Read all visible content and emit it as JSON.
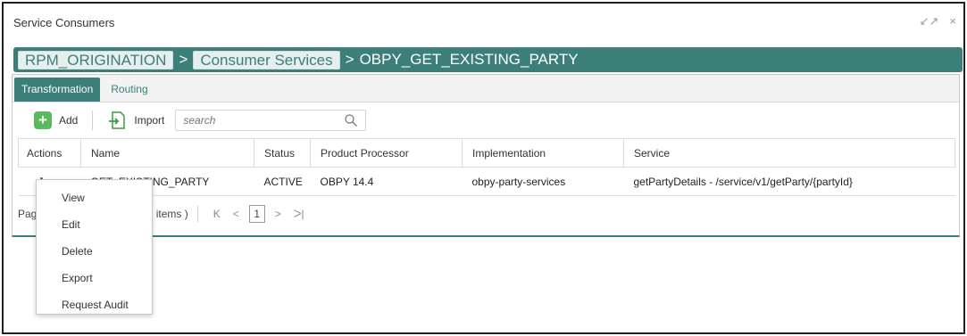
{
  "window": {
    "title": "Service Consumers",
    "minimize_icon": "↙↗",
    "close_icon": "×"
  },
  "breadcrumb": {
    "root": "RPM_ORIGINATION",
    "sep1": ">",
    "middle": "Consumer Services",
    "sep2": ">",
    "current": "OBPY_GET_EXISTING_PARTY"
  },
  "tabs": [
    {
      "label": "Transformation",
      "active": true
    },
    {
      "label": "Routing",
      "active": false
    }
  ],
  "toolbar": {
    "add_label": "Add",
    "import_label": "Import",
    "search_placeholder": "search"
  },
  "table": {
    "columns": [
      "Actions",
      "Name",
      "Status",
      "Product Processor",
      "Implementation",
      "Service"
    ],
    "rows": [
      {
        "actions": "⋮",
        "name": "GET_EXISTING_PARTY",
        "status": "ACTIVE",
        "product_processor": "OBPY 14.4",
        "implementation": "obpy-party-services",
        "service": "getPartyDetails - /service/v1/getParty/{partyId}"
      }
    ]
  },
  "pager": {
    "page_prefix": "Pag",
    "items_text": "of 1 items )",
    "first": "K",
    "prev": "<",
    "page": "1",
    "next": ">",
    "last": "ᐳ|"
  },
  "context_menu": {
    "items": [
      "View",
      "Edit",
      "Delete",
      "Export",
      "Request Audit"
    ]
  },
  "colors": {
    "accent": "#3b7f78",
    "add": "#5cb85c"
  }
}
